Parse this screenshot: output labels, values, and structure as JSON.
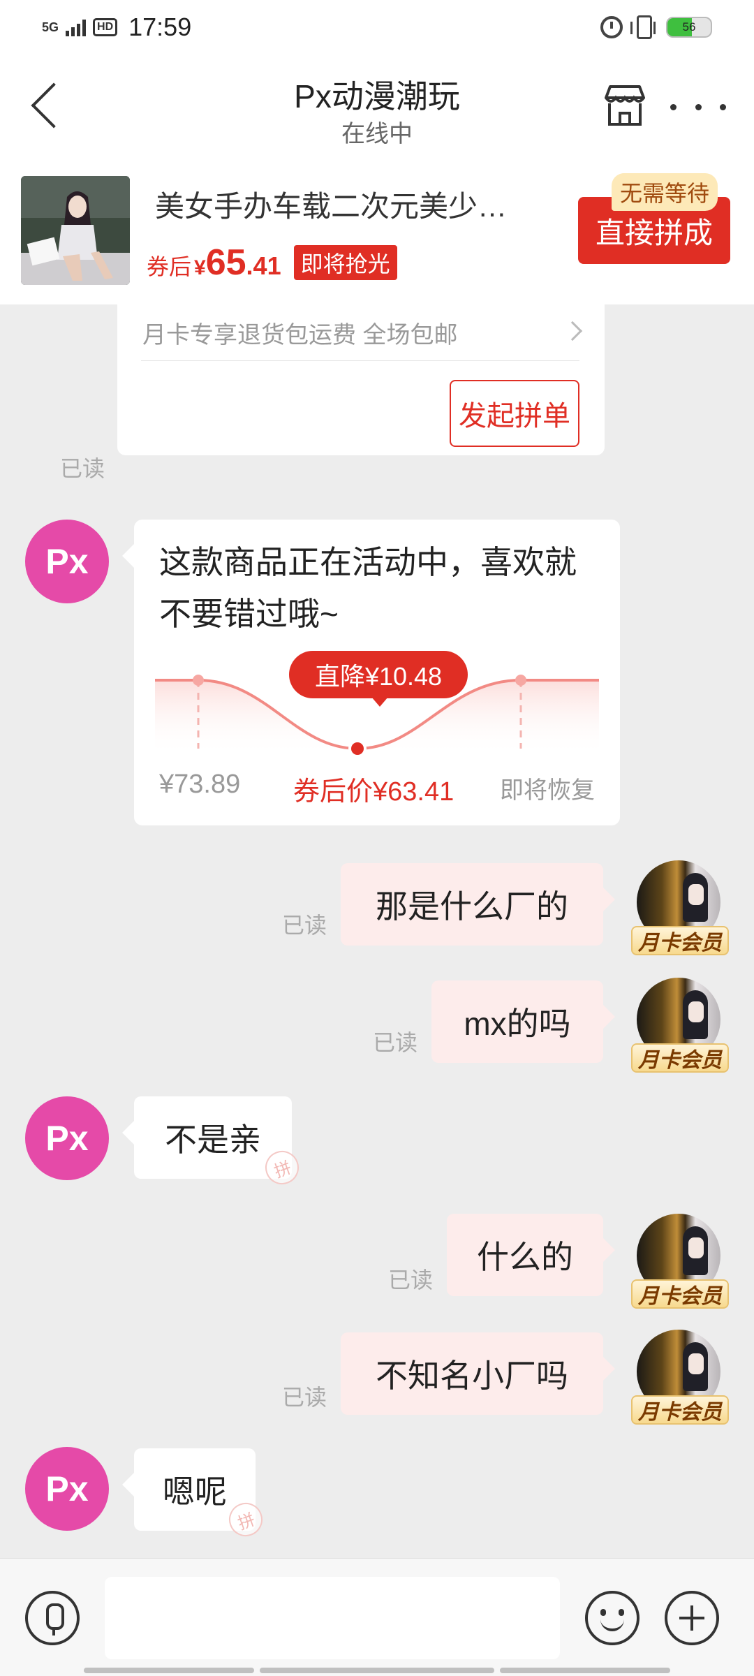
{
  "status_bar": {
    "network": "5G",
    "hd": "HD",
    "time": "17:59",
    "battery": "56",
    "battery_level": 0.56
  },
  "header": {
    "title": "Px动漫潮玩",
    "subtitle": "在线中"
  },
  "product": {
    "title": "美女手办车载二次元美少…",
    "price_label": "券后",
    "price_symbol": "¥",
    "price_int": "65",
    "price_dec": ".41",
    "badge": "即将抢光",
    "button_tag": "无需等待",
    "button_label": "直接拼成"
  },
  "chat": {
    "card_top": {
      "text": "月卡专享退货包运费 全场包邮",
      "button": "发起拼单",
      "read": "已读"
    },
    "promo": {
      "message": "这款商品正在活动中，喜欢就不要错过哦~",
      "drop_tag": "直降¥10.48",
      "old_price": "¥73.89",
      "new_price": "券后价¥63.41",
      "restore": "即将恢复"
    },
    "shop_avatar": "Px",
    "member_tag": "月卡会员",
    "read_label": "已读",
    "stamp": "拼",
    "messages": [
      {
        "side": "right",
        "text": "那是什么厂的"
      },
      {
        "side": "right",
        "text": "mx的吗"
      },
      {
        "side": "left",
        "text": "不是亲"
      },
      {
        "side": "right",
        "text": "什么的"
      },
      {
        "side": "right",
        "text": "不知名小厂吗"
      },
      {
        "side": "left",
        "text": "嗯呢"
      }
    ]
  },
  "input": {
    "placeholder": ""
  },
  "colors": {
    "accent": "#e02e24",
    "shop_avatar": "#e54aa8",
    "bubble_right": "#fdeceb"
  }
}
